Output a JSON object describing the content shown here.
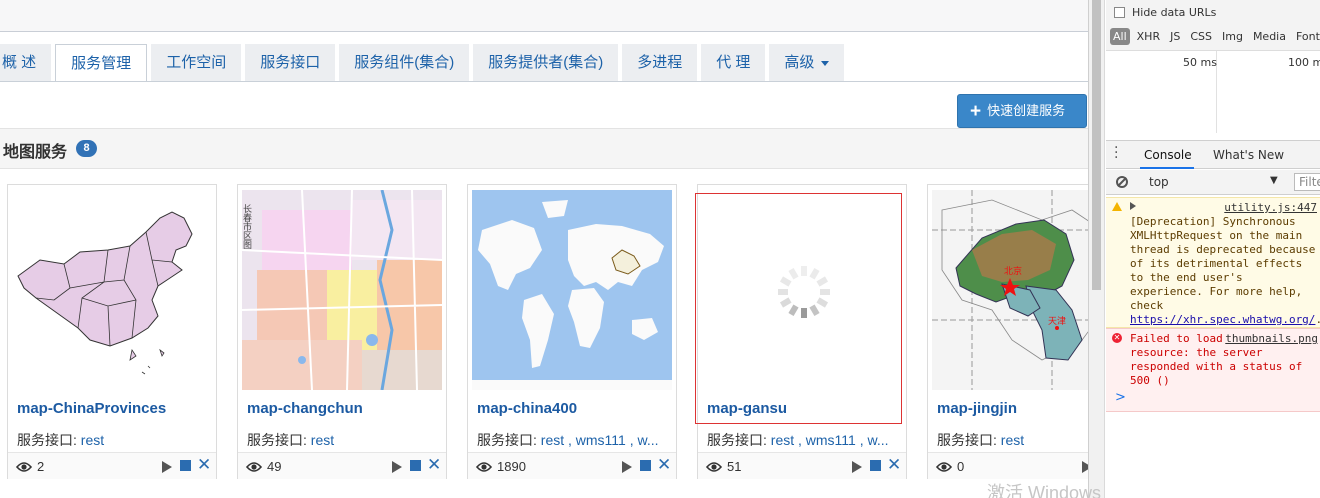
{
  "tabs": [
    {
      "label": "概 述",
      "active": false
    },
    {
      "label": "服务管理",
      "active": true
    },
    {
      "label": "工作空间",
      "active": false
    },
    {
      "label": "服务接口",
      "active": false
    },
    {
      "label": "服务组件(集合)",
      "active": false
    },
    {
      "label": "服务提供者(集合)",
      "active": false
    },
    {
      "label": "多进程",
      "active": false
    },
    {
      "label": "代 理",
      "active": false
    },
    {
      "label": "高级",
      "active": false
    }
  ],
  "quick_create_label": "快速创建服务",
  "section": {
    "title": "地图服务",
    "count": "8"
  },
  "cards": [
    {
      "title": "map-ChinaProvinces",
      "iface_prefix": "服务接口: ",
      "iface": "rest",
      "views": "2"
    },
    {
      "title": "map-changchun",
      "iface_prefix": "服务接口: ",
      "iface": "rest",
      "views": "49"
    },
    {
      "title": "map-china400",
      "iface_prefix": "服务接口: ",
      "iface": "rest , wms111 , w...",
      "views": "1890"
    },
    {
      "title": "map-gansu",
      "iface_prefix": "服务接口: ",
      "iface": "rest , wms111 , w...",
      "views": "51"
    },
    {
      "title": "map-jingjin",
      "iface_prefix": "服务接口: ",
      "iface": "rest",
      "views": "0"
    }
  ],
  "thumb_labels": {
    "changchun": "长春市区图",
    "beijing": "北京",
    "tianjin": "天津"
  },
  "watermark": "激活 Windows",
  "devtools": {
    "hide_data_urls": "Hide data URLs",
    "filters": [
      "All",
      "XHR",
      "JS",
      "CSS",
      "Img",
      "Media",
      "Font"
    ],
    "timeline": [
      "50 ms",
      "100 m"
    ],
    "tabs": [
      "Console",
      "What's New"
    ],
    "context": "top",
    "filter_placeholder": "Filter",
    "warning": {
      "source": "utility.js:447",
      "text": "[Deprecation] Synchronous XMLHttpRequest on the main thread is deprecated because of its detrimental effects to the end user's experience. For more help, check ",
      "url": "https://xhr.spec.whatwg.org/",
      "end": "."
    },
    "error": {
      "source": "thumbnails.png",
      "text": "Failed to load resource: the server responded with a status of 500 ()"
    },
    "prompt": ">"
  },
  "colors": {
    "accent": "#3a87c9",
    "link": "#1d62a9",
    "badge": "#3172b6",
    "error_border": "#dd3333"
  }
}
